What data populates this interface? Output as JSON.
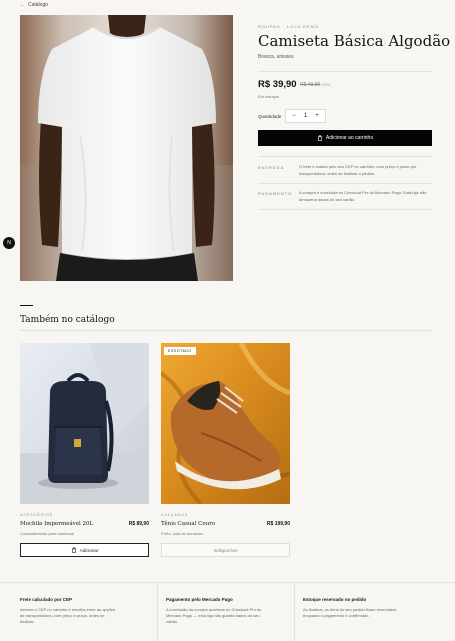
{
  "nav": {
    "back_label": "Catálogo"
  },
  "product": {
    "eyebrow": "Roupas · Loja Demo",
    "title": "Camiseta Básica Algodão",
    "subtitle": "Branca, unissex",
    "price": "R$ 39,90",
    "old_price": "R$ 49,90",
    "discount": "-20%",
    "stock": "Em estoque",
    "quantity_label": "Quantidade",
    "quantity_value": "1",
    "minus": "−",
    "plus": "+",
    "add_to_cart": "Adicionar ao carrinho",
    "shipping_label": "Entrega",
    "shipping_text": "O frete é cotado pelo seu CEP no carrinho, com preço e prazo por transportadora, antes de finalizar o pedido.",
    "payment_label": "Pagamento",
    "payment_text": "A compra é concluída no Checkout Pro do Mercado Pago. Esta loja não armazena dados do seu cartão."
  },
  "floating_button": {
    "label": "N"
  },
  "catalog": {
    "title": "Também no catálogo",
    "items": [
      {
        "category": "Acessórios",
        "name": "Mochila Impermeável 20L",
        "price": "R$ 89,90",
        "description": "Compartimento para notebook",
        "button": "Adicionar"
      },
      {
        "badge": "Esgotado",
        "category": "Calçados",
        "name": "Tênis Casual Couro",
        "price": "R$ 199,90",
        "description": "Preto, sola de borracha",
        "button": "Indisponível"
      }
    ]
  },
  "footer": [
    {
      "title": "Frete calculado por CEP",
      "text": "Informe o CEP no carrinho e escolha entre as opções de transportadora, com preço e prazo, antes de finalizar."
    },
    {
      "title": "Pagamento pelo Mercado Pago",
      "text": "A conclusão da compra acontece no Checkout Pro do Mercado Pago — esta loja não guarda dados do seu cartão."
    },
    {
      "title": "Estoque reservado no pedido",
      "text": "Ao finalizar, os itens do seu pedido ficam reservados enquanto o pagamento é confirmado."
    }
  ]
}
